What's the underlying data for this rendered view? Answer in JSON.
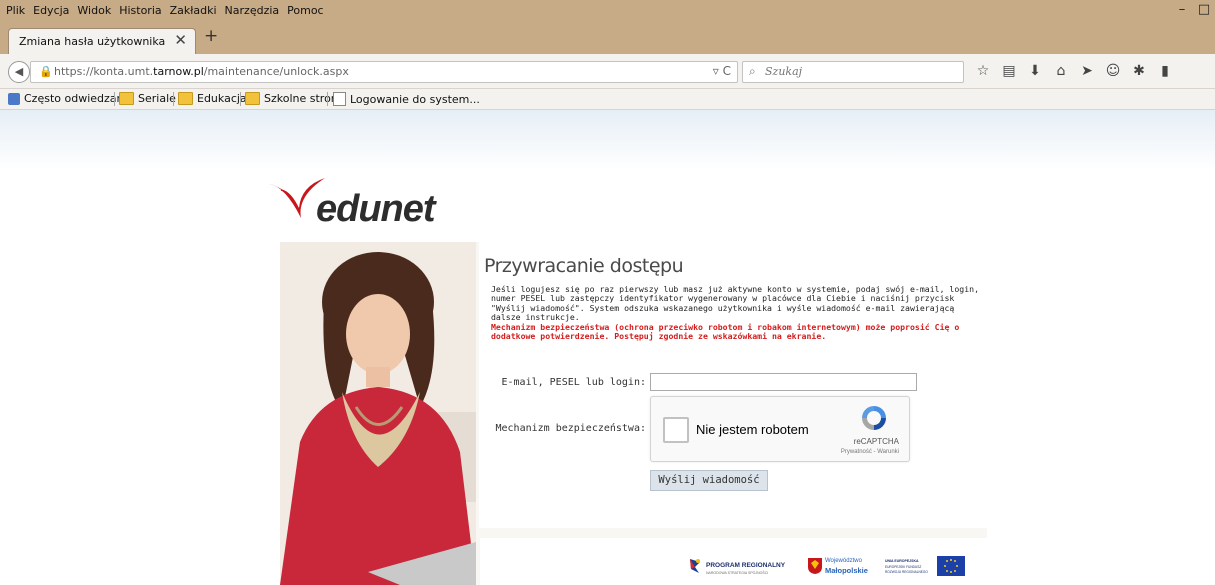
{
  "menu": {
    "items": [
      "Plik",
      "Edycja",
      "Widok",
      "Historia",
      "Zakładki",
      "Narzędzia",
      "Pomoc"
    ]
  },
  "window_controls": {
    "minimize": "–",
    "maximize": "□"
  },
  "tab": {
    "title": "Zmiana hasła użytkownika",
    "close": "✕",
    "new_tab": "+"
  },
  "url": {
    "prefix": "https://konta.umt.",
    "host": "tarnow.pl",
    "path": "/maintenance/unlock.aspx"
  },
  "search": {
    "placeholder": "Szukaj"
  },
  "bookmarks": [
    "Często odwiedzane",
    "Seriale",
    "Edukacja",
    "Szkolne strony",
    "Logowanie do system..."
  ],
  "logo": {
    "text": "edunet"
  },
  "form": {
    "title": "Przywracanie dostępu",
    "description": "Jeśli logujesz się po raz pierwszy lub masz już aktywne konto w systemie, podaj swój e-mail, login, numer PESEL lub zastępczy identyfikator wygenerowany w placówce dla Ciebie i naciśnij przycisk \"Wyślij wiadomość\". System odszuka wskazanego użytkownika i wyśle wiadomość e-mail zawierającą dalsze instrukcje.",
    "warning": "Mechanizm bezpieczeństwa (ochrona przeciwko robotom i robakom internetowym) może poprosić Cię o dodatkowe potwierdzenie. Postępuj zgodnie ze wskazówkami na ekranie.",
    "email_label": "E-mail, PESEL lub login:",
    "email_value": "",
    "security_label": "Mechanizm bezpieczeństwa:",
    "submit": "Wyślij wiadomość"
  },
  "captcha": {
    "label": "Nie jestem robotem",
    "brand": "reCAPTCHA",
    "links": "Prywatność - Warunki"
  },
  "footer": {
    "program": "PROGRAM REGIONALNY",
    "program_sub": "NARODOWA STRATEGIA SPÓJNOŚCI",
    "region_top": "Województwo",
    "region": "Małopolskie",
    "eu_line1": "UNIA EUROPEJSKA",
    "eu_line2": "EUROPEJSKI FUNDUSZ",
    "eu_line3": "ROZWOJU REGIONALNEGO"
  }
}
